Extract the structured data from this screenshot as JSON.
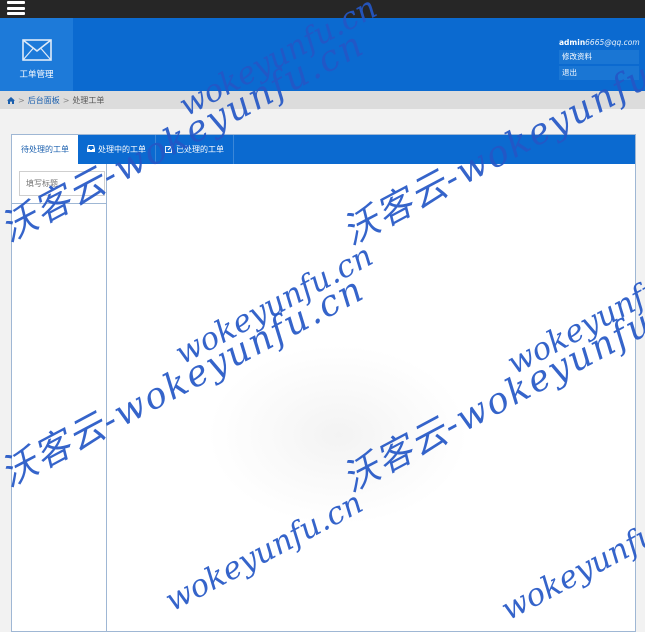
{
  "header": {
    "module_label": "工单管理",
    "user": {
      "name": "admin",
      "email": "6665@qq.com"
    },
    "edit_profile": "修改资料",
    "logout": "退出"
  },
  "breadcrumb": {
    "home_icon": "home-icon",
    "dashboard": "后台面板",
    "current": "处理工单"
  },
  "tabs": [
    {
      "label": "待处理的工单",
      "icon": ""
    },
    {
      "label": "处理中的工单",
      "icon": "inbox-icon"
    },
    {
      "label": "已处理的工单",
      "icon": "edit-icon"
    }
  ],
  "search": {
    "placeholder": "填写标题"
  },
  "watermark": {
    "cn": "沃客云-wokeyunfu.cn",
    "en": "wokeyunfu.cn",
    "brand": "沃客云",
    "color": "#2457c6"
  },
  "colors": {
    "header_blue": "#0b6ad0",
    "topbar": "#262626"
  }
}
